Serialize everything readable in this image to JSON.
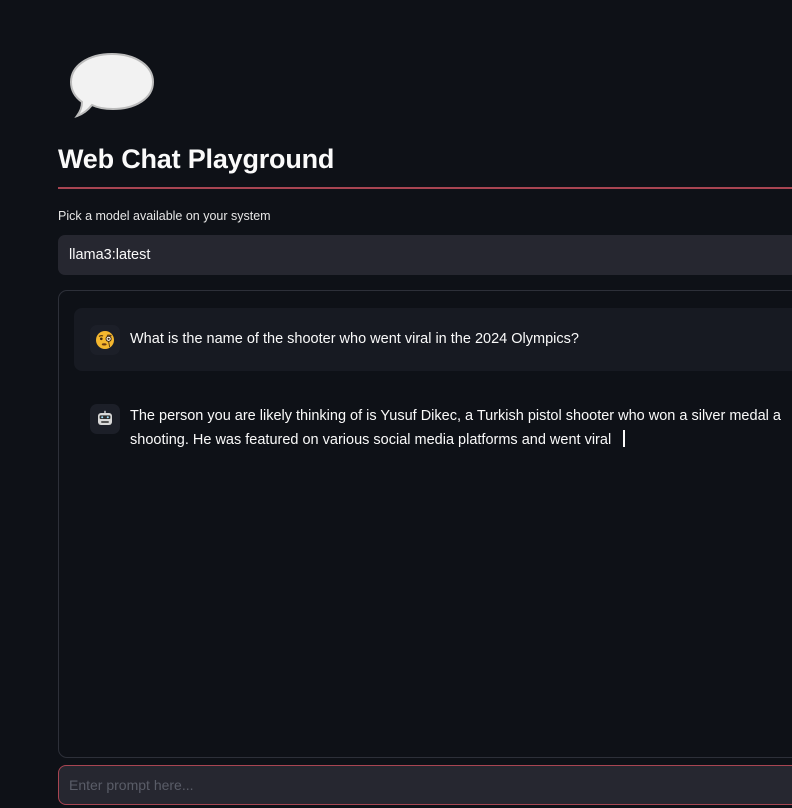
{
  "app": {
    "title": "Web Chat Playground"
  },
  "model_picker": {
    "label": "Pick a model available on your system",
    "selected": "llama3:latest"
  },
  "messages": [
    {
      "role": "user",
      "avatar_icon": "face-with-monocle-icon",
      "text_lines": [
        "What is the name of the shooter who went viral in the 2024 Olympics?"
      ]
    },
    {
      "role": "assistant",
      "avatar_icon": "robot-face-icon",
      "text_lines": [
        "The person you are likely thinking of is Yusuf Dikec, a Turkish pistol shooter who won a silver medal a",
        "shooting. He was featured on various social media platforms and went viral"
      ]
    }
  ],
  "prompt": {
    "placeholder": "Enter prompt here...",
    "value": ""
  },
  "colors": {
    "background": "#0e1117",
    "accent": "#a84552",
    "input_bg": "#262730",
    "user_msg_bg": "#171a22",
    "text": "#fafafa"
  }
}
